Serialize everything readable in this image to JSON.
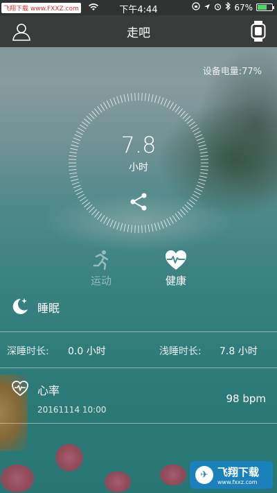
{
  "status_bar": {
    "source_tag": "飞翔下载 www.FXXZ.com",
    "time": "下午4:44",
    "battery_percent": "67%",
    "battery_level": 0.67
  },
  "nav": {
    "title": "走吧",
    "left_icon": "user-icon",
    "right_icon": "watch-icon"
  },
  "device_battery": "设备电量:77%",
  "dial": {
    "value": "7.8",
    "unit": "小时"
  },
  "tabs": [
    {
      "label": "运动",
      "icon": "running-icon",
      "active": false
    },
    {
      "label": "健康",
      "icon": "heart-pulse-icon",
      "active": true
    }
  ],
  "sleep": {
    "title": "睡眠",
    "deep_label": "深睡时长:",
    "deep_value": "0.0 小时",
    "light_label": "浅睡时长:",
    "light_value": "7.8 小时"
  },
  "heart_rate": {
    "title": "心率",
    "date": "20161114 10:00",
    "value": "98 bpm"
  },
  "watermark": {
    "main": "飞翔下载",
    "sub": "www.fxxz.com"
  },
  "colors": {
    "nav_bg": "#343434",
    "battery_fill": "#4cd964",
    "watermark_bg": "#1982c8"
  }
}
